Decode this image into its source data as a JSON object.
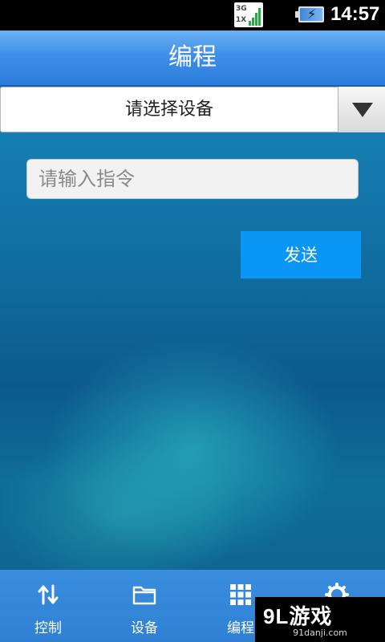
{
  "status_bar": {
    "network_top": "3G",
    "network_bottom": "1X",
    "time": "14:57"
  },
  "header": {
    "title": "编程"
  },
  "device_selector": {
    "selected": "请选择设备",
    "icon": "dropdown-triangle-icon"
  },
  "command": {
    "placeholder": "请输入指令",
    "value": ""
  },
  "send_button": {
    "label": "发送",
    "color": "#0a96f5"
  },
  "bottom_nav": {
    "items": [
      {
        "label": "控制",
        "icon": "sort-arrows-icon"
      },
      {
        "label": "设备",
        "icon": "folder-icon"
      },
      {
        "label": "编程",
        "icon": "grid-icon"
      },
      {
        "label": "",
        "icon": "gear-icon"
      }
    ]
  },
  "watermark": {
    "logo": "9L游戏",
    "url": "91danji.com"
  }
}
